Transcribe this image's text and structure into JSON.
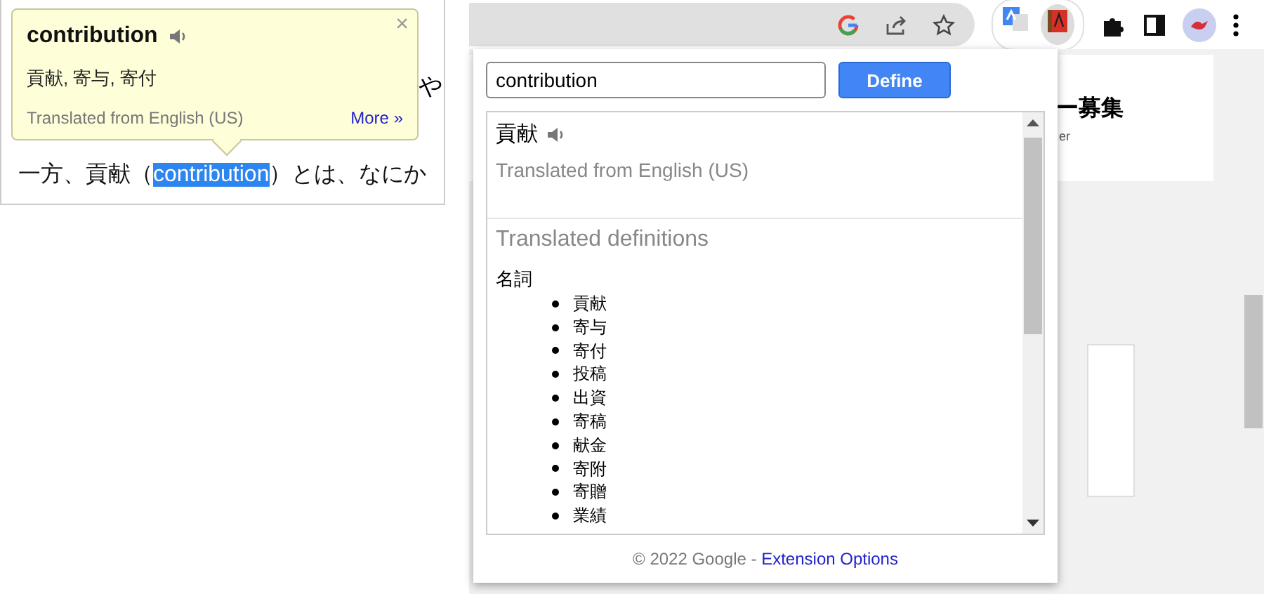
{
  "article": {
    "lines": [
      {
        "parts": [
          {
            "text": "一方、貢献（",
            "selected": false
          },
          {
            "text": "contribution",
            "selected": true
          },
          {
            "text": "）とは、なにか",
            "selected": false
          }
        ]
      }
    ],
    "edge_text": "や",
    "tooltip": {
      "word": "contribution",
      "translations": "貢献, 寄与, 寄付",
      "source": "Translated from English (US)",
      "more": "More »",
      "close": "×"
    }
  },
  "browser": {
    "extension_active": true
  },
  "page": {
    "heading": "ー募集",
    "subheading": "er"
  },
  "popup": {
    "query": "contribution",
    "button": "Define",
    "word": "貢献",
    "source": "Translated from English (US)",
    "section_title": "Translated definitions",
    "part_of_speech": "名詞",
    "definitions": [
      "貢献",
      "寄与",
      "寄付",
      "投稿",
      "出資",
      "寄稿",
      "献金",
      "寄附",
      "寄贈",
      "業績"
    ],
    "footer": "© 2022 Google - ",
    "footer_link": "Extension Options"
  }
}
